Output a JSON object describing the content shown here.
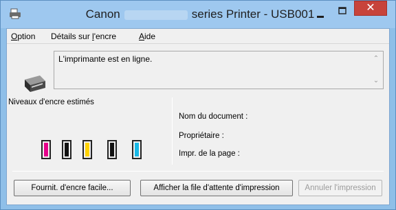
{
  "window": {
    "title_prefix": "Canon",
    "title_suffix": "series Printer - USB001",
    "close_glyph": "✕",
    "minimize_glyph": "—",
    "maximize_glyph": "□"
  },
  "menu": {
    "option_mnemonic": "O",
    "option_rest": "ption",
    "details_prefix": "Détails sur ",
    "details_mnemonic": "l",
    "details_rest": "'encre",
    "help_mnemonic": "A",
    "help_rest": "ide"
  },
  "status": {
    "message": "L'imprimante est en ligne."
  },
  "ink": {
    "label": "Niveaux d'encre estimés",
    "cartridges": [
      {
        "name": "magenta",
        "color": "#e6008a"
      },
      {
        "name": "black-pigment",
        "color": "#111111"
      },
      {
        "name": "yellow",
        "color": "#ffd200"
      },
      {
        "name": "black",
        "color": "#111111"
      },
      {
        "name": "cyan",
        "color": "#17b8e6"
      }
    ]
  },
  "job": {
    "document_label": "Nom du document :",
    "owner_label": "Propriétaire :",
    "page_label": "Impr. de la page :"
  },
  "buttons": {
    "ink_order": "Fournit. d'encre facile...",
    "show_queue": "Afficher la file d'attente d'impression",
    "cancel": "Annuler l'impression"
  },
  "colors": {
    "title_bar": "#9ec8ef",
    "close_button": "#c7433b"
  }
}
